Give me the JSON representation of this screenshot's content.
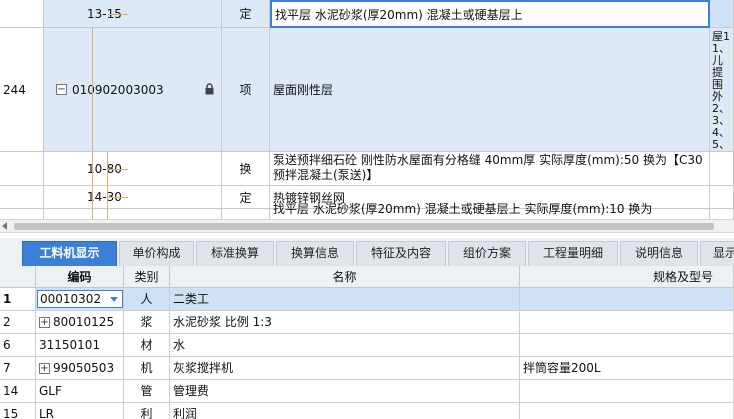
{
  "upper_grid": {
    "row_13_15": {
      "code": "13-15",
      "type": "定",
      "name": "找平层 水泥砂浆(厚20mm) 混凝土或硬基层上"
    },
    "row_244": {
      "num": "244",
      "expander": "−",
      "code": "010902003003",
      "type": "项",
      "name": "屋面刚性层",
      "extra_lines": [
        "屋1",
        "1、",
        "儿提",
        "围外",
        "2、",
        "3、",
        "4、",
        "5、"
      ]
    },
    "row_10_80": {
      "code": "10-80",
      "type": "换",
      "name": "泵送预拌细石砼 刚性防水屋面有分格缝 40mm厚  实际厚度(mm):50  换为【C30预拌混凝土(泵送)】"
    },
    "row_14_30": {
      "code": "14-30",
      "type": "定",
      "name": "热镀锌钢丝网"
    },
    "row_partial": {
      "name": "找平层 水泥砂浆(厚20mm) 混凝土或硬基层上 实际厚度(mm):10 换为"
    }
  },
  "tabs": [
    {
      "label": "工料机显示",
      "active": true
    },
    {
      "label": "单价构成"
    },
    {
      "label": "标准换算"
    },
    {
      "label": "换算信息"
    },
    {
      "label": "特征及内容"
    },
    {
      "label": "组价方案"
    },
    {
      "label": "工程量明细"
    },
    {
      "label": "说明信息"
    },
    {
      "label": "显示"
    }
  ],
  "lower_grid": {
    "headers": {
      "code": "编码",
      "category": "类别",
      "name": "名称",
      "spec": "规格及型号"
    },
    "rows": [
      {
        "no": "1",
        "code": "00010302",
        "category": "人",
        "name": "二类工",
        "spec": "",
        "selected": true
      },
      {
        "no": "2",
        "expand": "+",
        "code": "80010125",
        "category": "浆",
        "name": "水泥砂浆 比例 1:3",
        "spec": ""
      },
      {
        "no": "6",
        "code": "31150101",
        "category": "材",
        "name": "水",
        "spec": ""
      },
      {
        "no": "7",
        "expand": "+",
        "code": "99050503",
        "category": "机",
        "name": "灰浆搅拌机",
        "spec": "拌筒容量200L"
      },
      {
        "no": "14",
        "code": "GLF",
        "category": "管",
        "name": "管理费",
        "spec": ""
      },
      {
        "no": "15",
        "code": "LR",
        "category": "利",
        "name": "利润",
        "spec": ""
      }
    ]
  },
  "colors": {
    "accent": "#3c7fd6",
    "row_highlight": "#dde9f6",
    "tree_line": "#d8b26e"
  }
}
